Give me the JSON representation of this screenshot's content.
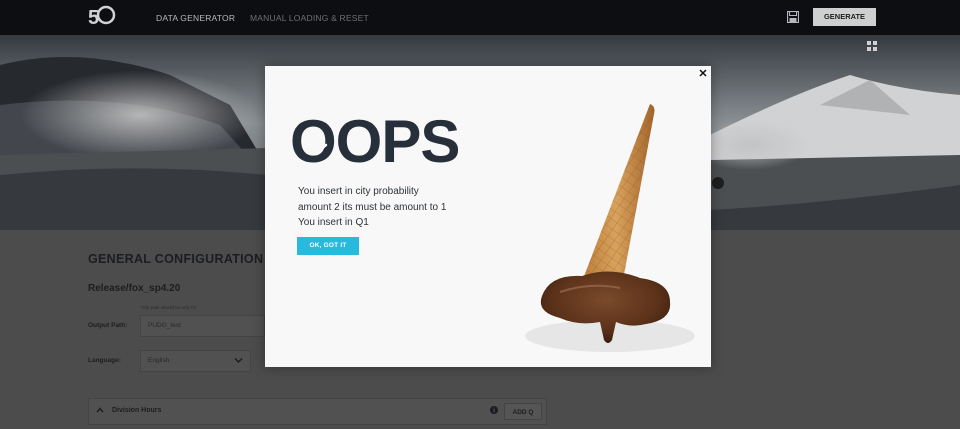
{
  "app": {
    "logo": {
      "icon": "brand-logo-icon"
    },
    "nav": [
      {
        "label": "DATA GENERATOR",
        "active": true
      },
      {
        "label": "MANUAL LOADING & RESET",
        "active": false
      }
    ],
    "save_icon": "save-icon",
    "generate_label": "GENERATE"
  },
  "hero": {
    "grid_icon": "grid-view-icon"
  },
  "config": {
    "title": "GENERAL CONFIGURATION",
    "release": "Release/fox_sp4.20",
    "note": "*The path should be only P1",
    "output_path": {
      "label": "Output Path:",
      "value": "PUDG_test"
    },
    "language": {
      "label": "Language:",
      "value": "English"
    },
    "division": {
      "label": "Division Hours",
      "add_label": "ADD Q"
    }
  },
  "modal": {
    "title": "OOPS",
    "message_lines": [
      "You insert in city probability",
      "amount 2 its must be amount to 1",
      "You insert in Q1"
    ],
    "ok_label": "OK, GOT IT",
    "close_icon": "close-icon",
    "illustration": "melting-ice-cream-cone",
    "colors": {
      "accent": "#27b9de",
      "title": "#262f3a"
    }
  }
}
